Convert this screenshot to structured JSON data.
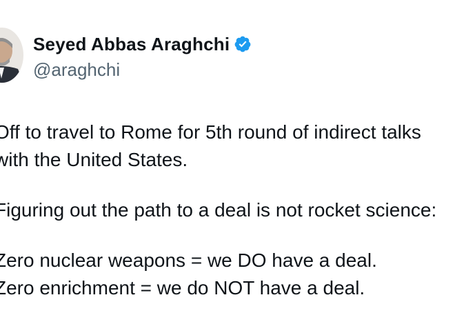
{
  "tweet": {
    "author": {
      "display_name": "Seyed Abbas Araghchi",
      "handle": "@araghchi",
      "verified_icon": "verified-badge-icon",
      "badge_color": "#1d9bf0"
    },
    "body": {
      "line1": "Off to travel to Rome for 5th round of indirect talks",
      "line2": "with the United States.",
      "line3": "Figuring out the path to a deal is not rocket science:",
      "line4": "Zero nuclear weapons = we DO have a deal.",
      "line5": "Zero enrichment = we do NOT have a deal."
    }
  }
}
